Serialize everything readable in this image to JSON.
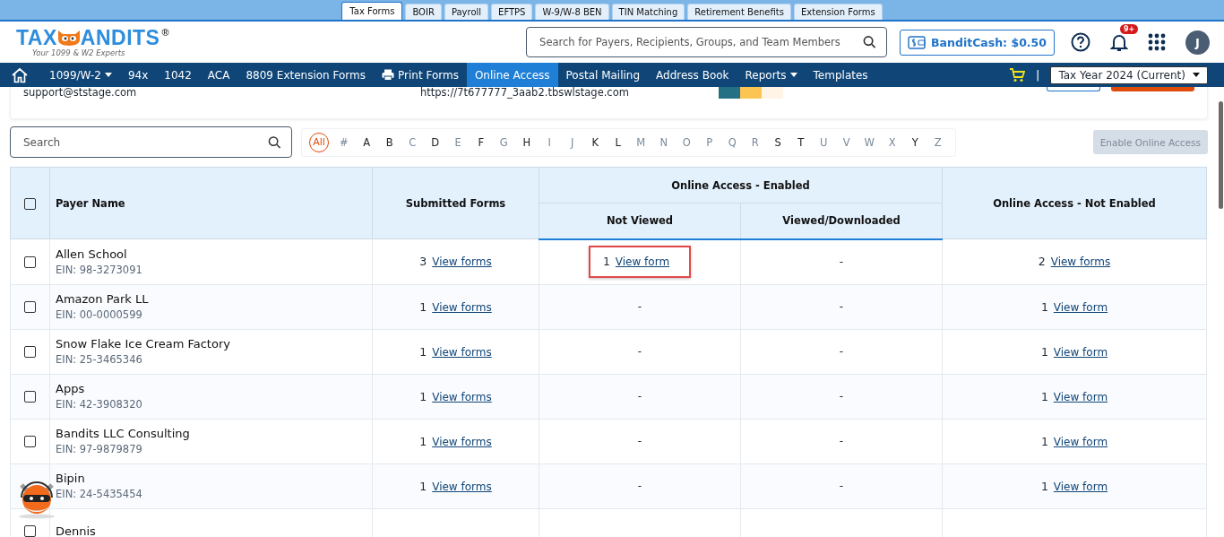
{
  "product_tabs": [
    {
      "label": "Tax Forms",
      "selected": true
    },
    {
      "label": "BOIR",
      "selected": false
    },
    {
      "label": "Payroll",
      "selected": false
    },
    {
      "label": "EFTPS",
      "selected": false
    },
    {
      "label": "W-9/W-8 BEN",
      "selected": false
    },
    {
      "label": "TIN Matching",
      "selected": false
    },
    {
      "label": "Retirement Benefits",
      "selected": false
    },
    {
      "label": "Extension Forms",
      "selected": false
    }
  ],
  "logo": {
    "left": "TAX",
    "right": "ANDITS",
    "mark": "®",
    "tagline": "Your 1099 & W2 Experts"
  },
  "search": {
    "placeholder": "Search for Payers, Recipients, Groups, and Team Members"
  },
  "bandit_cash": "BanditCash: $0.50",
  "notifications_badge": "9+",
  "avatar": "J",
  "nav": [
    {
      "label": "1099/W-2",
      "kind": "menu",
      "selected": false
    },
    {
      "label": "94x",
      "kind": "link",
      "selected": false
    },
    {
      "label": "1042",
      "kind": "link",
      "selected": false
    },
    {
      "label": "ACA",
      "kind": "link",
      "selected": false
    },
    {
      "label": "8809 Extension Forms",
      "kind": "link",
      "selected": false
    },
    {
      "label": "Print Forms",
      "kind": "print",
      "selected": false
    },
    {
      "label": "Online Access",
      "kind": "link",
      "selected": true
    },
    {
      "label": "Postal Mailing",
      "kind": "link",
      "selected": false
    },
    {
      "label": "Address Book",
      "kind": "link",
      "selected": false
    },
    {
      "label": "Reports",
      "kind": "menu",
      "selected": false
    },
    {
      "label": "Templates",
      "kind": "link",
      "selected": false
    }
  ],
  "divider": "|",
  "tax_year": "Tax Year 2024 (Current)",
  "info_card": {
    "email": "support@ststage.com",
    "url": "https://7t677777_3aab2.tbswlstage.com",
    "swatches": [
      {
        "color": "#236f84"
      },
      {
        "color": "#fcc552"
      },
      {
        "color": "#fff4e6"
      }
    ]
  },
  "payer_search": {
    "placeholder": "Search"
  },
  "letters": [
    {
      "label": "All",
      "selected": true,
      "disabled": false
    },
    {
      "label": "#",
      "selected": false,
      "disabled": true
    },
    {
      "label": "A",
      "selected": false,
      "disabled": false
    },
    {
      "label": "B",
      "selected": false,
      "disabled": false
    },
    {
      "label": "C",
      "selected": false,
      "disabled": true
    },
    {
      "label": "D",
      "selected": false,
      "disabled": false
    },
    {
      "label": "E",
      "selected": false,
      "disabled": true
    },
    {
      "label": "F",
      "selected": false,
      "disabled": false
    },
    {
      "label": "G",
      "selected": false,
      "disabled": true
    },
    {
      "label": "H",
      "selected": false,
      "disabled": false
    },
    {
      "label": "I",
      "selected": false,
      "disabled": true
    },
    {
      "label": "J",
      "selected": false,
      "disabled": true
    },
    {
      "label": "K",
      "selected": false,
      "disabled": false
    },
    {
      "label": "L",
      "selected": false,
      "disabled": false
    },
    {
      "label": "M",
      "selected": false,
      "disabled": true
    },
    {
      "label": "N",
      "selected": false,
      "disabled": true
    },
    {
      "label": "O",
      "selected": false,
      "disabled": true
    },
    {
      "label": "P",
      "selected": false,
      "disabled": true
    },
    {
      "label": "Q",
      "selected": false,
      "disabled": true
    },
    {
      "label": "R",
      "selected": false,
      "disabled": true
    },
    {
      "label": "S",
      "selected": false,
      "disabled": false
    },
    {
      "label": "T",
      "selected": false,
      "disabled": false
    },
    {
      "label": "U",
      "selected": false,
      "disabled": true
    },
    {
      "label": "V",
      "selected": false,
      "disabled": true
    },
    {
      "label": "W",
      "selected": false,
      "disabled": true
    },
    {
      "label": "X",
      "selected": false,
      "disabled": true
    },
    {
      "label": "Y",
      "selected": false,
      "disabled": false
    },
    {
      "label": "Z",
      "selected": false,
      "disabled": true
    }
  ],
  "enable_button": {
    "label": "Enable Online Access",
    "disabled": true
  },
  "table": {
    "columns": {
      "payer": "Payer Name",
      "submitted": "Submitted Forms",
      "enabled_group": "Online Access - Enabled",
      "not_viewed": "Not Viewed",
      "viewed": "Viewed/Downloaded",
      "not_enabled": "Online Access - Not Enabled"
    },
    "header_checked": false,
    "rows": [
      {
        "checked": false,
        "name": "Allen School",
        "ein": "EIN: 98-3273091",
        "submitted": {
          "count": "3",
          "link": "View forms"
        },
        "not_viewed": {
          "count": "1",
          "link": "View form",
          "highlighted": true
        },
        "viewed": {
          "text": "-"
        },
        "not_enabled": {
          "count": "2",
          "link": "View forms"
        }
      },
      {
        "checked": false,
        "name": "Amazon Park LL",
        "ein": "EIN: 00-0000599",
        "submitted": {
          "count": "1",
          "link": "View forms"
        },
        "not_viewed": {
          "text": "-"
        },
        "viewed": {
          "text": "-"
        },
        "not_enabled": {
          "count": "1",
          "link": "View form"
        }
      },
      {
        "checked": false,
        "name": "Snow Flake Ice Cream Factory",
        "ein": "EIN: 25-3465346",
        "submitted": {
          "count": "1",
          "link": "View forms"
        },
        "not_viewed": {
          "text": "-"
        },
        "viewed": {
          "text": "-"
        },
        "not_enabled": {
          "count": "1",
          "link": "View form"
        }
      },
      {
        "checked": false,
        "name": "Apps",
        "ein": "EIN: 42-3908320",
        "submitted": {
          "count": "1",
          "link": "View forms"
        },
        "not_viewed": {
          "text": "-"
        },
        "viewed": {
          "text": "-"
        },
        "not_enabled": {
          "count": "1",
          "link": "View form"
        }
      },
      {
        "checked": false,
        "name": "Bandits LLC Consulting",
        "ein": "EIN: 97-9879879",
        "submitted": {
          "count": "1",
          "link": "View forms"
        },
        "not_viewed": {
          "text": "-"
        },
        "viewed": {
          "text": "-"
        },
        "not_enabled": {
          "count": "1",
          "link": "View form"
        }
      },
      {
        "name": "Bipin",
        "ein": "EIN: 24-5435454",
        "submitted": {
          "count": "1",
          "link": "View forms"
        },
        "not_viewed": {
          "text": "-"
        },
        "viewed": {
          "text": "-"
        },
        "not_enabled": {
          "count": "1",
          "link": "View form"
        }
      },
      {
        "checked": false,
        "name": "Dennis"
      }
    ]
  }
}
